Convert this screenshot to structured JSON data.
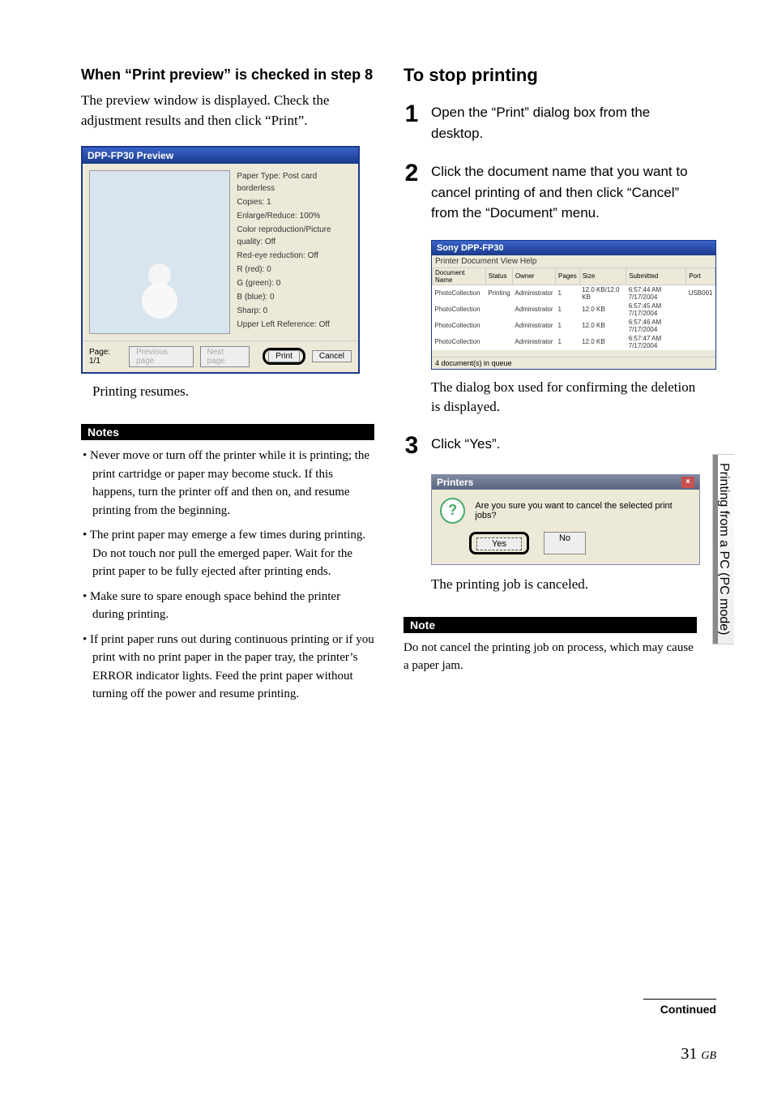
{
  "left": {
    "heading": "When “Print preview” is checked in step 8",
    "intro": "The preview window is displayed. Check the adjustment results and then click “Print”.",
    "preview_window": {
      "title": "DPP-FP30 Preview",
      "info_lines": [
        "Paper Type: Post card borderless",
        "Copies: 1",
        "Enlarge/Reduce: 100%",
        "Color reproduction/Picture quality: Off",
        "Red-eye reduction: Off",
        "R (red): 0",
        "G (green): 0",
        "B (blue): 0",
        "Sharp: 0",
        "Upper Left Reference: Off"
      ],
      "page_counter": "Page: 1/1",
      "btn_prev": "Previous page",
      "btn_next": "Next page",
      "btn_print": "Print",
      "btn_cancel": "Cancel"
    },
    "resume_line": "Printing resumes.",
    "notes_label": "Notes",
    "notes": [
      "Never move or turn off the printer while it is printing;  the print cartridge or paper may become stuck.  If this happens, turn the printer off and then on, and resume printing from the beginning.",
      "The print paper may emerge a few times during printing.  Do not touch nor pull the emerged paper.  Wait for the print paper to be fully ejected after printing ends.",
      "Make sure to spare enough space behind the printer during printing.",
      "If print paper runs out during continuous printing or if you print with no print paper in the paper tray, the printer’s ERROR indicator lights. Feed the print paper without turning off the power and resume printing."
    ]
  },
  "right": {
    "heading": "To stop printing",
    "step1": "Open the “Print” dialog box from the desktop.",
    "step2": "Click the document name that you want to cancel printing of and then click “Cancel” from the “Document” menu.",
    "queue": {
      "title": "Sony DPP-FP30",
      "menus": "Printer   Document   View   Help",
      "columns": [
        "Document Name",
        "Status",
        "Owner",
        "Pages",
        "Size",
        "Submitted",
        "Port"
      ],
      "rows": [
        [
          "PhotoCollection",
          "Printing",
          "Administrator",
          "1",
          "12.0 KB/12.0 KB",
          "6:57:44 AM  7/17/2004",
          "USB001"
        ],
        [
          "PhotoCollection",
          "",
          "Administrator",
          "1",
          "12.0 KB",
          "6:57:45 AM  7/17/2004",
          ""
        ],
        [
          "PhotoCollection",
          "",
          "Administrator",
          "1",
          "12.0 KB",
          "6:57:46 AM  7/17/2004",
          ""
        ],
        [
          "PhotoCollection",
          "",
          "Administrator",
          "1",
          "12.0 KB",
          "6:57:47 AM  7/17/2004",
          ""
        ]
      ],
      "status": "4 document(s) in queue"
    },
    "after_step2": "The dialog box used for confirming the deletion is displayed.",
    "step3": "Click “Yes”.",
    "confirm": {
      "title": "Printers",
      "msg": "Are you sure you want to cancel the selected print jobs?",
      "yes": "Yes",
      "no": "No"
    },
    "after_step3": "The printing job is canceled.",
    "note_label": "Note",
    "note_text": "Do not cancel the printing job on process, which may cause a paper jam."
  },
  "side_tab": "Printing from a PC (PC mode)",
  "footer": {
    "continued": "Continued",
    "page": "31",
    "suffix": "GB"
  }
}
